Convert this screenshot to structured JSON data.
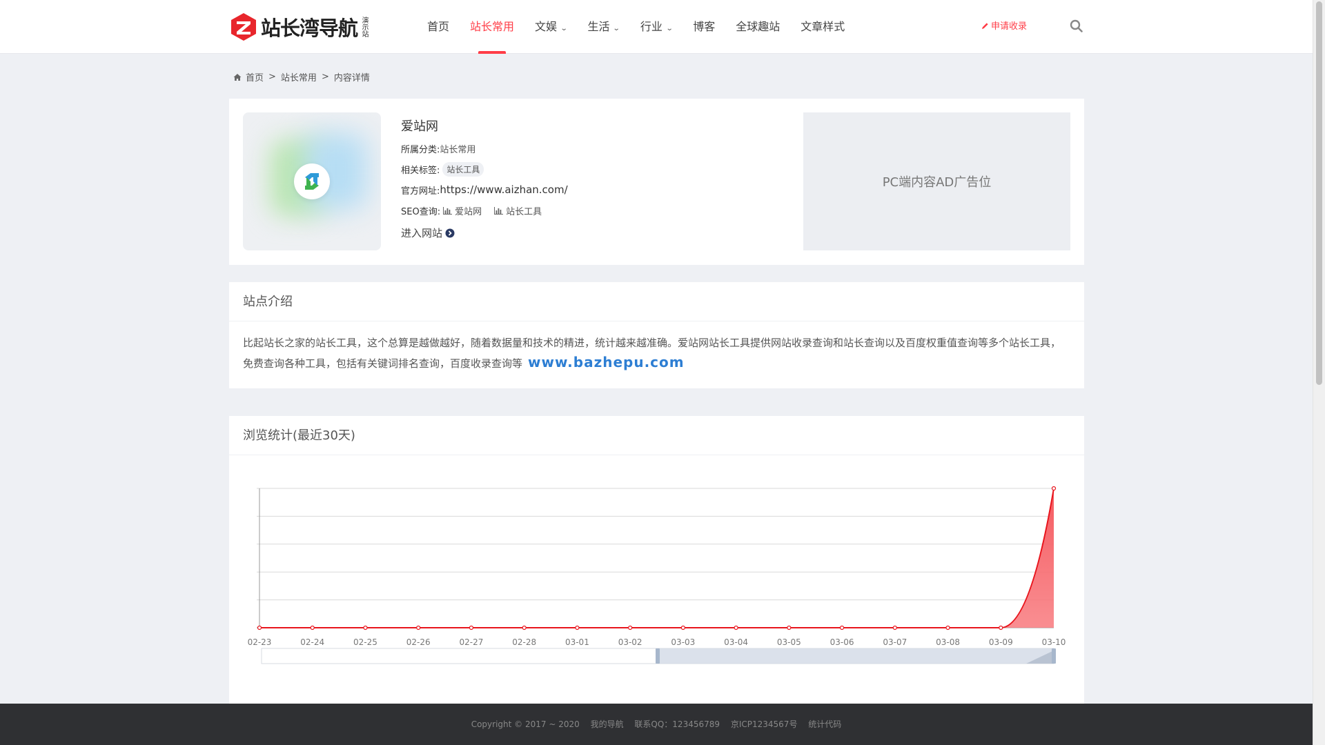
{
  "header": {
    "logo_text": "站长湾导航",
    "logo_sub": "演示站",
    "nav": [
      {
        "label": "首页",
        "dropdown": false,
        "active": false
      },
      {
        "label": "站长常用",
        "dropdown": false,
        "active": true
      },
      {
        "label": "文娱",
        "dropdown": true,
        "active": false
      },
      {
        "label": "生活",
        "dropdown": true,
        "active": false
      },
      {
        "label": "行业",
        "dropdown": true,
        "active": false
      },
      {
        "label": "博客",
        "dropdown": false,
        "active": false
      },
      {
        "label": "全球趣站",
        "dropdown": false,
        "active": false
      },
      {
        "label": "文章样式",
        "dropdown": false,
        "active": false
      }
    ],
    "apply_label": "申请收录",
    "accent_color": "#ff3d47"
  },
  "breadcrumb": {
    "home": "首页",
    "category": "站长常用",
    "current": "内容详情",
    "separator": ">"
  },
  "site": {
    "name": "爱站网",
    "category_label": "所属分类:",
    "category_value": "站长常用",
    "tags_label": "相关标签:",
    "tags": [
      "站长工具"
    ],
    "url_label": "官方网址:",
    "url": "https://www.aizhan.com/",
    "seo_label": "SEO查询:",
    "seo_links": [
      "爱站网",
      "站长工具"
    ],
    "enter_label": "进入网站"
  },
  "ad": {
    "text": "PC端内容AD广告位"
  },
  "intro": {
    "title": "站点介绍",
    "text": "比起站长之家的站长工具，这个总算是越做越好，随着数据量和技术的精进，统计越来越准确。爱站网站长工具提供网站收录查询和站长查询以及百度权重值查询等多个站长工具，免费查询各种工具，包括有关键词排名查询，百度收录查询等",
    "watermark": "www.bazhepu.com"
  },
  "stats": {
    "title": "浏览统计(最近30天)"
  },
  "chart_data": {
    "type": "area",
    "title": "浏览统计(最近30天)",
    "x": [
      "02-23",
      "02-24",
      "02-25",
      "02-26",
      "02-27",
      "02-28",
      "03-01",
      "03-02",
      "03-03",
      "03-04",
      "03-05",
      "03-06",
      "03-07",
      "03-08",
      "03-09",
      "03-10"
    ],
    "series": [
      {
        "values": [
          0,
          0,
          0,
          0,
          0,
          0,
          0,
          0,
          0,
          0,
          0,
          0,
          0,
          0,
          0,
          1
        ]
      }
    ],
    "ylim": [
      0,
      1
    ],
    "grid": true,
    "color": "#e8141c",
    "fill_color": "#f87a7e",
    "data_zoom": {
      "start_fraction": 0.5,
      "end_fraction": 1.0
    }
  },
  "footer": {
    "copyright": "Copyright © 2017 ~ 2020",
    "site_name": "我的导航",
    "contact": "联系QQ：123456789",
    "icp": "京ICP1234567号",
    "stats_code": "统计代码"
  }
}
